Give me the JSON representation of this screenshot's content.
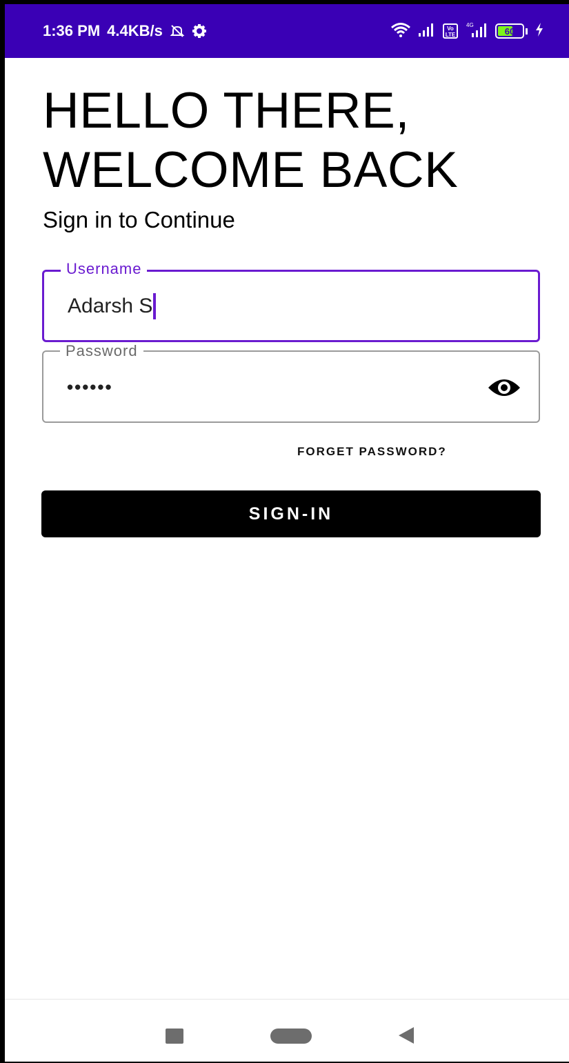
{
  "status_bar": {
    "time": "1:36 PM",
    "net_speed": "4.4KB/s",
    "battery_level": "60",
    "icons": [
      "mute-icon",
      "gear-icon",
      "wifi-icon",
      "signal-icon",
      "volte-icon",
      "signal-4g-icon",
      "battery-icon",
      "charging-icon"
    ],
    "colors": {
      "background": "#3a00b5",
      "battery_fill": "#7cf51a"
    }
  },
  "login": {
    "headline_line1": "HELLO THERE,",
    "headline_line2": "WELCOME BACK",
    "subtitle": "Sign in to Continue",
    "username": {
      "label": "Username",
      "value": "Adarsh S"
    },
    "password": {
      "label": "Password",
      "masked_value": "••••••",
      "toggle_icon": "eye-icon"
    },
    "forgot_password": "FORGET PASSWORD?",
    "signin_button": "SIGN-IN",
    "colors": {
      "accent": "#6a1bd0",
      "button": "#000000"
    }
  },
  "nav_bar": {
    "icons": [
      "recents-icon",
      "home-icon",
      "back-icon"
    ]
  }
}
